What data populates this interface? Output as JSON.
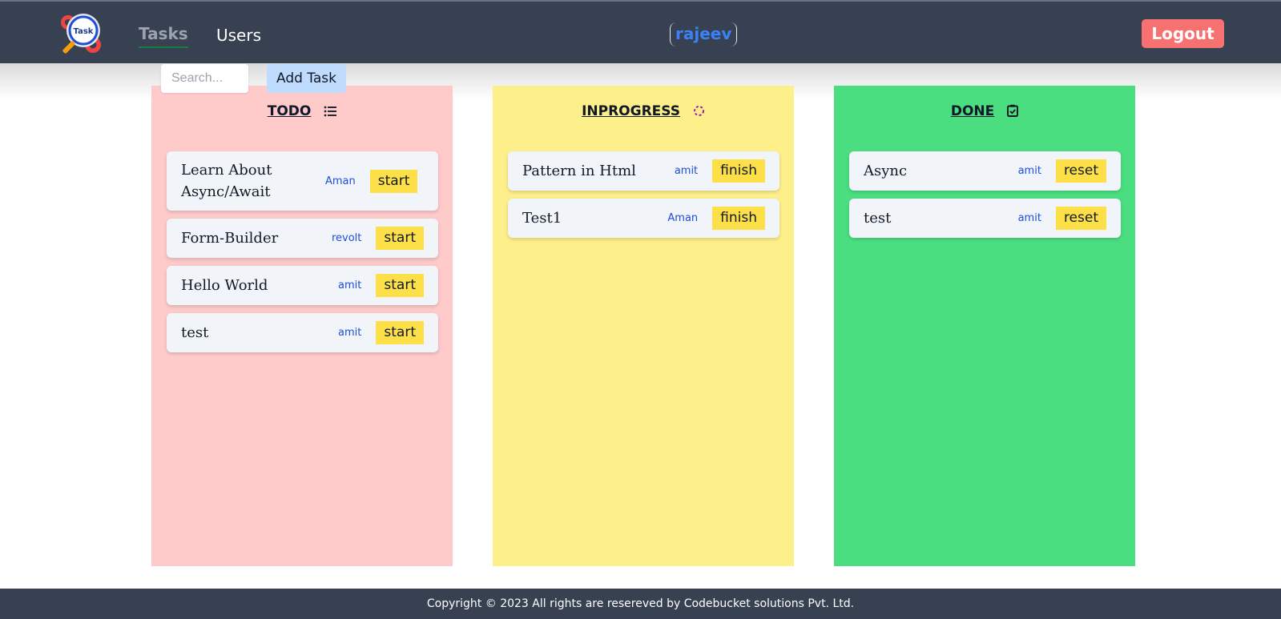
{
  "nav": {
    "logo_text": "Task",
    "tasks": "Tasks",
    "users": "Users",
    "username": "rajeev",
    "logout": "Logout"
  },
  "toolbar": {
    "search_placeholder": "Search...",
    "add_task": "Add Task"
  },
  "columns": [
    {
      "title": "TODO",
      "icon": "list-icon",
      "color": "#fecaca",
      "cards": [
        {
          "title": "Learn About Async/Await",
          "assignee": "Aman",
          "action": "start"
        },
        {
          "title": "Form-Builder",
          "assignee": "revolt",
          "action": "start"
        },
        {
          "title": "Hello World",
          "assignee": "amit",
          "action": "start"
        },
        {
          "title": "test",
          "assignee": "amit",
          "action": "start"
        }
      ]
    },
    {
      "title": "INPROGRESS",
      "icon": "loader-icon",
      "color": "#fdef8a",
      "cards": [
        {
          "title": "Pattern in Html",
          "assignee": "amit",
          "action": "finish"
        },
        {
          "title": "Test1",
          "assignee": "Aman",
          "action": "finish"
        }
      ]
    },
    {
      "title": "DONE",
      "icon": "clipboard-check-icon",
      "color": "#4ade80",
      "cards": [
        {
          "title": "Async",
          "assignee": "amit",
          "action": "reset"
        },
        {
          "title": "test",
          "assignee": "amit",
          "action": "reset"
        }
      ]
    }
  ],
  "footer": {
    "text": "Copyright © 2023 All rights are resereved by Codebucket solutions Pvt. Ltd."
  }
}
